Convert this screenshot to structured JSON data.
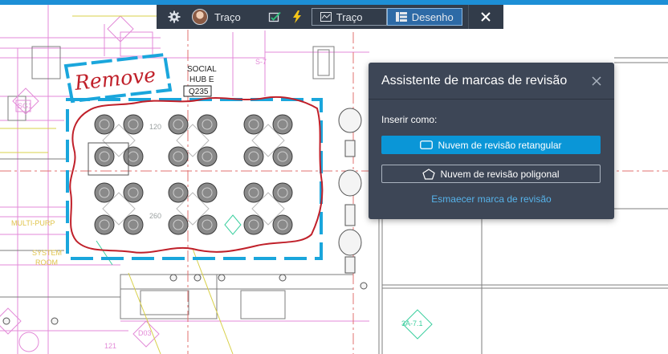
{
  "toolbar": {
    "settings_icon": "gear-icon",
    "user_label": "Traço",
    "markup_icon": "markup-check-icon",
    "lightning_icon": "lightning-icon",
    "trace_tab_label": "Traço",
    "drawing_tab_label": "Desenho",
    "close_icon": "close-icon"
  },
  "drawing": {
    "remove_label": "Remove",
    "room_name_line1": "SOCIAL",
    "room_name_line2": "HUB E",
    "room_number": "Q235",
    "tags": [
      "SG1",
      "120",
      "260",
      "D03",
      "121",
      "3A-7.1",
      "SYSTEM",
      "ROOM",
      "MULTI-PURP",
      "S-7"
    ]
  },
  "panel": {
    "title": "Assistente de marcas de revisão",
    "insert_label": "Inserir como:",
    "rect_button_label": "Nuvem de revisão retangular",
    "poly_button_label": "Nuvem de revisão poligonal",
    "fade_link_label": "Esmaecer marca de revisão"
  },
  "colors": {
    "toolbar_bg": "#323c4a",
    "panel_bg": "#3d4656",
    "accent_blue": "#0a96d7",
    "link_blue": "#57b3ea",
    "markup_red": "#c0202a",
    "markup_cyan": "#1aa6dc"
  }
}
